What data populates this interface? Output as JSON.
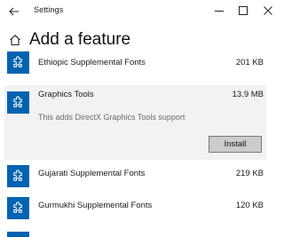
{
  "window": {
    "title": "Settings"
  },
  "header": {
    "title": "Add a feature"
  },
  "features": [
    {
      "name": "Ethiopic Supplemental Fonts",
      "size": "201 KB",
      "icon": "puzzle-icon"
    },
    {
      "name": "Graphics Tools",
      "size": "13.9 MB",
      "icon": "puzzle-icon",
      "description": "This adds DirectX Graphics Tools support",
      "action_label": "Install",
      "expanded": true
    },
    {
      "name": "Gujarati Supplemental Fonts",
      "size": "219 KB",
      "icon": "puzzle-icon"
    },
    {
      "name": "Gurmukhi Supplemental Fonts",
      "size": "120 KB",
      "icon": "puzzle-icon"
    }
  ],
  "colors": {
    "accent": "#0063b1",
    "selected_bg": "#f2f2f2",
    "button_bg": "#cccccc"
  }
}
